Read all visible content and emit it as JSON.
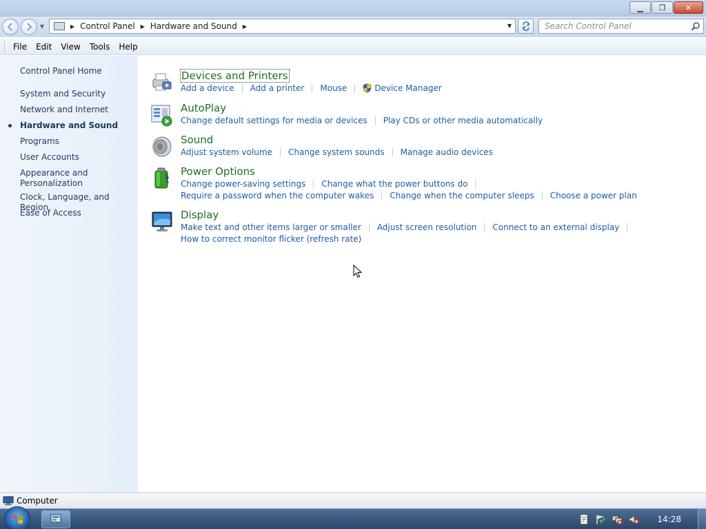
{
  "window": {
    "minimize_glyph": "▁",
    "maximize_glyph": "❐",
    "close_glyph": "✕"
  },
  "address": {
    "crumbs": [
      "Control Panel",
      "Hardware and Sound"
    ],
    "search_placeholder": "Search Control Panel"
  },
  "menu": [
    "File",
    "Edit",
    "View",
    "Tools",
    "Help"
  ],
  "leftnav": {
    "home": "Control Panel Home",
    "items": [
      "System and Security",
      "Network and Internet",
      "Hardware and Sound",
      "Programs",
      "User Accounts",
      "Appearance and",
      "Personalization",
      "Clock, Language, and Region",
      "Ease of Access"
    ],
    "active_index": 2
  },
  "categories": [
    {
      "title": "Devices and Printers",
      "icon": "printer-icon",
      "rows": [
        [
          "Add a device",
          "Add a printer",
          "Mouse",
          "Device Manager"
        ]
      ]
    },
    {
      "title": "AutoPlay",
      "icon": "autoplay-icon",
      "rows": [
        [
          "Change default settings for media or devices",
          "Play CDs or other media automatically"
        ]
      ]
    },
    {
      "title": "Sound",
      "icon": "speaker-icon",
      "rows": [
        [
          "Adjust system volume",
          "Change system sounds",
          "Manage audio devices"
        ]
      ]
    },
    {
      "title": "Power Options",
      "icon": "battery-icon",
      "rows": [
        [
          "Change power-saving settings",
          "Change what the power buttons do"
        ],
        [
          "Require a password when the computer wakes",
          "Change when the computer sleeps",
          "Choose a power plan"
        ]
      ]
    },
    {
      "title": "Display",
      "icon": "monitor-icon",
      "rows": [
        [
          "Make text and other items larger or smaller",
          "Adjust screen resolution",
          "Connect to an external display"
        ],
        [
          "How to correct monitor flicker (refresh rate)"
        ]
      ]
    }
  ],
  "status": {
    "text": "Computer"
  },
  "taskbar": {
    "clock": "14:28"
  },
  "colors": {
    "link": "#1e5ba8",
    "category_title": "#1e6e25",
    "nav_text": "#1e395b"
  }
}
